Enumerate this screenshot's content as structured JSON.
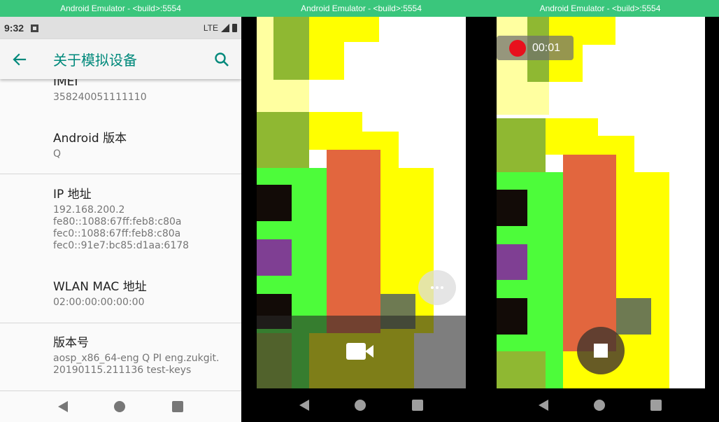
{
  "windows": [
    {
      "title": "Android Emulator - <build>:5554"
    },
    {
      "title": "Android Emulator - <build>:5554"
    },
    {
      "title": "Android Emulator - <build>:5554"
    }
  ],
  "status_bar": {
    "time": "9:32",
    "network": "LTE"
  },
  "app_bar": {
    "title": "关于模拟设备"
  },
  "prefs": [
    {
      "title": "IMEI",
      "summary": "358240051111110"
    },
    {
      "title": "Android 版本",
      "summary": "Q"
    },
    {
      "title": "IP 地址",
      "summary": "192.168.200.2\nfe80::1088:67ff:feb8:c80a\nfec0::1088:67ff:feb8:c80a\nfec0::91e7:bc85:d1aa:6178"
    },
    {
      "title": "WLAN MAC 地址",
      "summary": "02:00:00:00:00:00"
    },
    {
      "title": "版本号",
      "summary": "aosp_x86_64-eng Q PI eng.zukgit.\n20190115.211136 test-keys"
    }
  ],
  "recording": {
    "elapsed": "00:01"
  },
  "icons": [
    "back-arrow-icon",
    "search-icon",
    "nav-back-icon",
    "nav-home-icon",
    "nav-recent-icon",
    "video-camera-icon",
    "more-dots-icon",
    "record-dot-icon",
    "stop-icon"
  ],
  "colors": {
    "titlebar": "#3ac67c",
    "accent": "#00897b",
    "record": "#e8101d"
  }
}
